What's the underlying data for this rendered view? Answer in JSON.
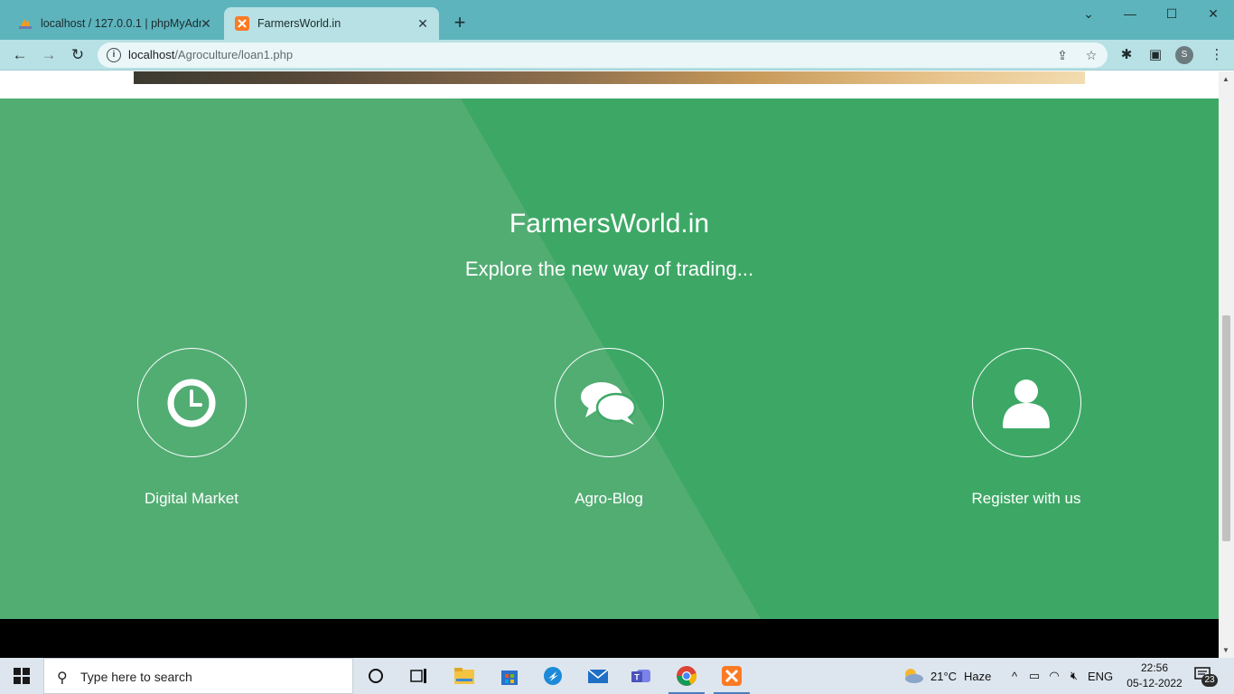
{
  "browser": {
    "tabs": [
      {
        "title": "localhost / 127.0.0.1 | phpMyAdmi",
        "active": false
      },
      {
        "title": "FarmersWorld.in",
        "active": true
      }
    ],
    "new_tab_label": "+",
    "url_host": "localhost",
    "url_path": "/Agroculture/loan1.php",
    "profile_initial": "S"
  },
  "page": {
    "brand": "FarmersWorld.in",
    "tagline": "Explore the new way of trading...",
    "features": [
      {
        "label": "Digital Market",
        "icon": "clock-icon"
      },
      {
        "label": "Agro-Blog",
        "icon": "chat-bubbles-icon"
      },
      {
        "label": "Register with us",
        "icon": "user-icon"
      }
    ],
    "colors": {
      "green": "#3da866",
      "green_light": "#4fad72",
      "footer": "#000000"
    }
  },
  "taskbar": {
    "search_placeholder": "Type here to search",
    "weather_temp": "21°C",
    "weather_desc": "Haze",
    "language": "ENG",
    "time": "22:56",
    "date": "05-12-2022",
    "notification_count": "23"
  }
}
